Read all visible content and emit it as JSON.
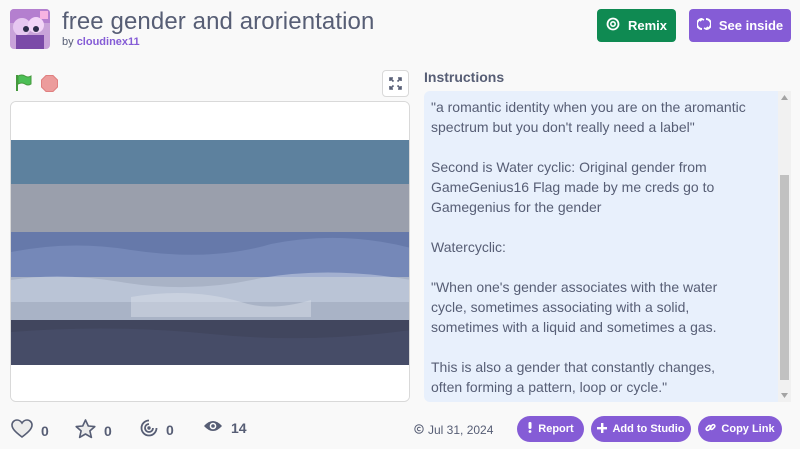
{
  "header": {
    "title": "free gender and arorientation",
    "by_prefix": "by ",
    "username": "cloudinex11",
    "remix_label": "Remix",
    "see_inside_label": "See inside"
  },
  "instructions": {
    "heading": "Instructions",
    "text": "\"a romantic identity when you are on the aromantic\nspectrum but you don't really need a label\"\n\nSecond is Water cyclic: Original gender from\nGameGenius16 Flag made by me creds go to\nGamegenius for the gender\n\nWatercyclic:\n\n\"When one's gender associates with the water\ncycle, sometimes associating with a solid,\nsometimes with a liquid and sometimes a gas.\n\nThis is also a gender that constantly changes,\noften forming a pattern, loop or cycle.\""
  },
  "stats": {
    "loves": "0",
    "favorites": "0",
    "remixes": "0",
    "views": "14"
  },
  "footer": {
    "date": "Jul 31, 2024",
    "report_label": "Report",
    "add_to_studio_label": "Add to Studio",
    "copy_link_label": "Copy Link"
  },
  "colors": {
    "accent": "#855cd6",
    "remix": "#0f8a52",
    "flag_green": "#4cbf56",
    "stop_red": "#ec9c9c",
    "instructions_bg": "#e8f0fc"
  },
  "icons": [
    "green-flag-icon",
    "stop-icon",
    "fullscreen-icon",
    "remix-icon",
    "see-inside-icon",
    "heart-icon",
    "star-icon",
    "remix-count-icon",
    "eye-icon",
    "copyright-icon",
    "report-icon",
    "plus-icon",
    "link-icon"
  ]
}
